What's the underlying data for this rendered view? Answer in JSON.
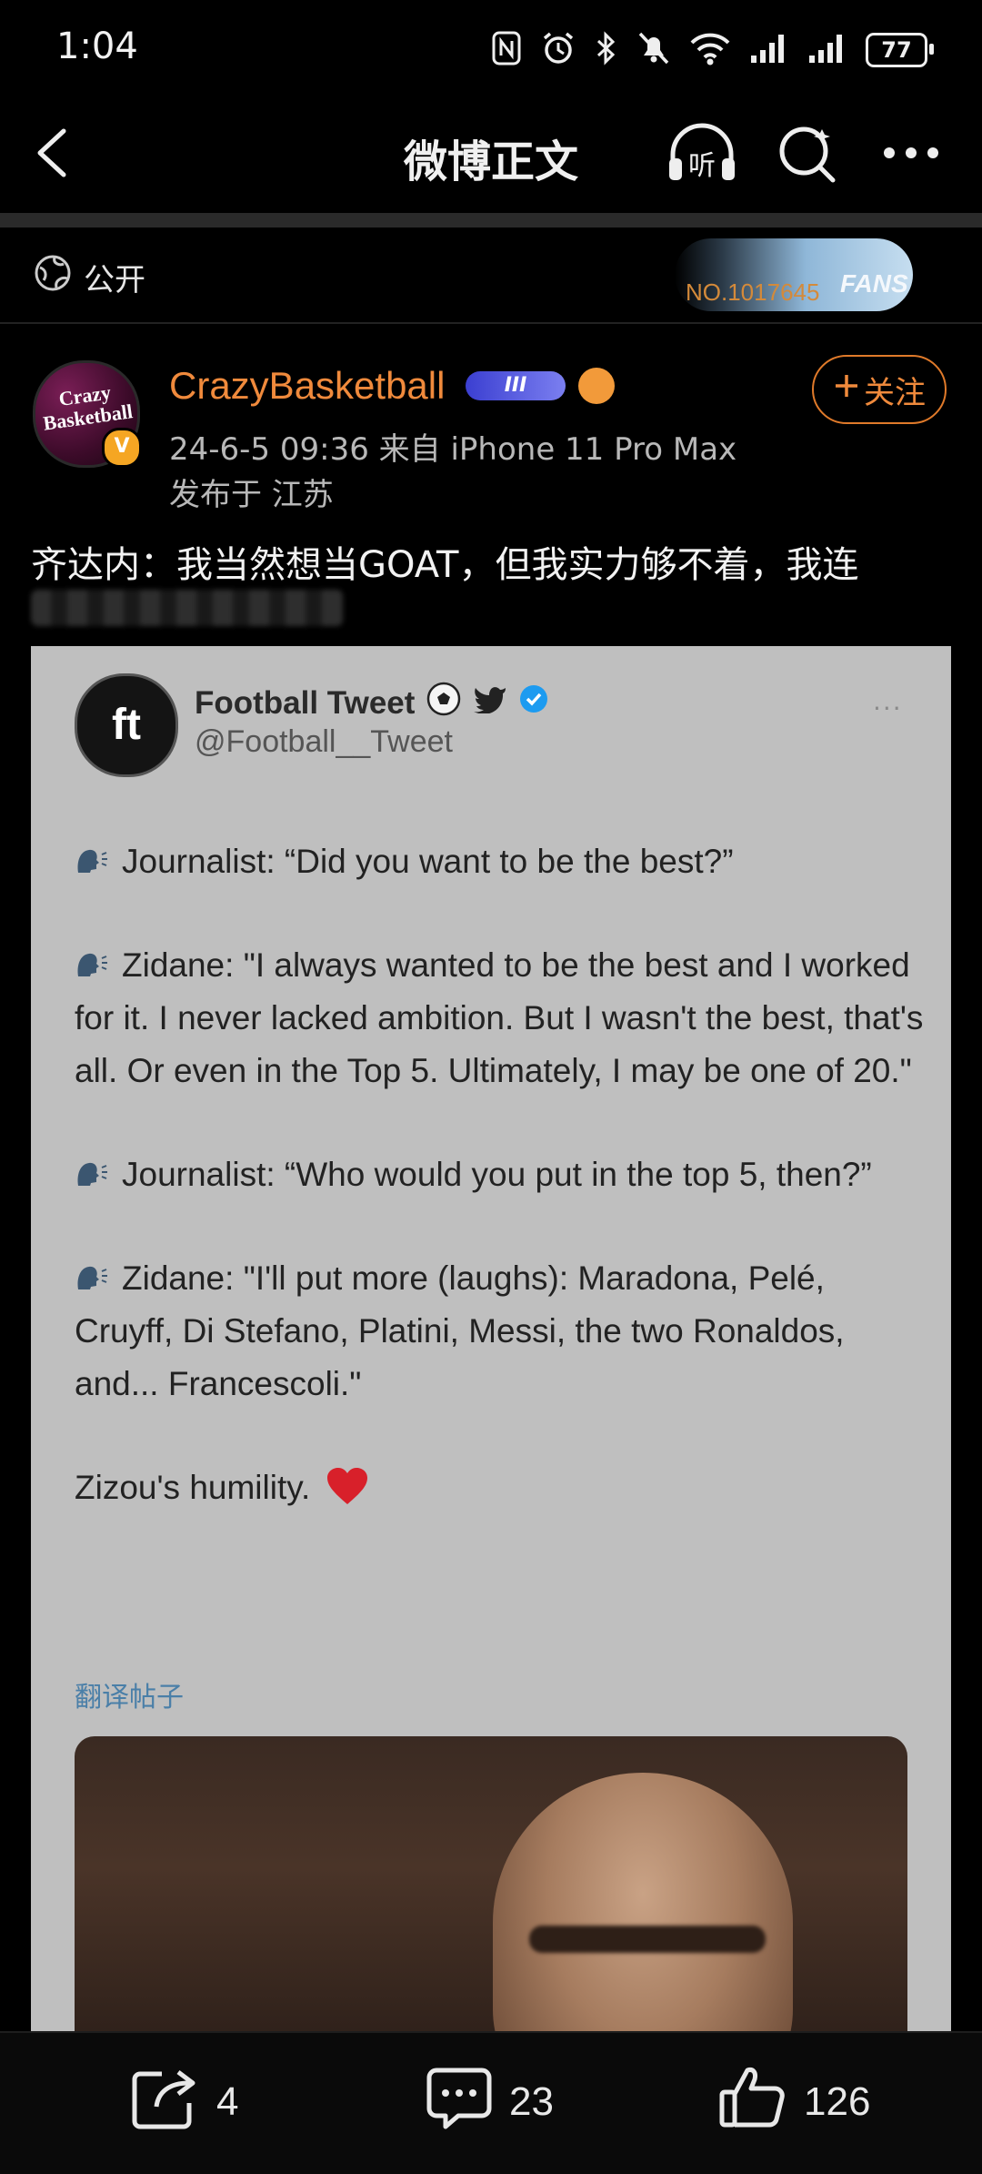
{
  "status_bar": {
    "time": "1:04",
    "battery": "77"
  },
  "nav": {
    "title": "微博正文"
  },
  "visibility": {
    "label": "公开"
  },
  "fans_badge": {
    "number": "NO.1017645",
    "label": "FANS"
  },
  "author": {
    "name": "CrazyBasketball",
    "avatar_text": "Crazy Basketball",
    "level": "III",
    "meta": "24-6-5 09:36  来自 iPhone 11 Pro Max",
    "location": "发布于 江苏",
    "follow_label": "关注"
  },
  "post": {
    "text": "齐达内：我当然想当GOAT，但我实力够不着，我连"
  },
  "tweet": {
    "avatar_text": "ft",
    "name": "Football Tweet",
    "handle": "@Football__Tweet",
    "more": "···",
    "p1": "Journalist: “Did you want to be the best?”",
    "p2": "Zidane: \"I always wanted to be the best and I worked for it. I never lacked ambition. But I wasn't the best, that's all. Or even in the Top 5. Ultimately, I may be one of 20.\"",
    "p3": "Journalist: “Who would you put in the top 5, then?”",
    "p4": "Zidane: \"I'll put more (laughs): Maradona, Pelé, Cruyff, Di Stefano, Platini, Messi, the two Ronaldos, and... Francescoli.\"",
    "p5": "Zizou's humility.",
    "translate": "翻译帖子"
  },
  "actions": {
    "reposts": "4",
    "comments": "23",
    "likes": "126"
  },
  "colors": {
    "accent": "#f08a3c",
    "background": "#000000",
    "card": "#bfbfbf",
    "link": "#4a7fa8"
  },
  "icons": [
    "back-arrow-icon",
    "listen-icon",
    "search-icon",
    "more-icon",
    "globe-icon",
    "repost-icon",
    "comment-icon",
    "like-icon"
  ]
}
